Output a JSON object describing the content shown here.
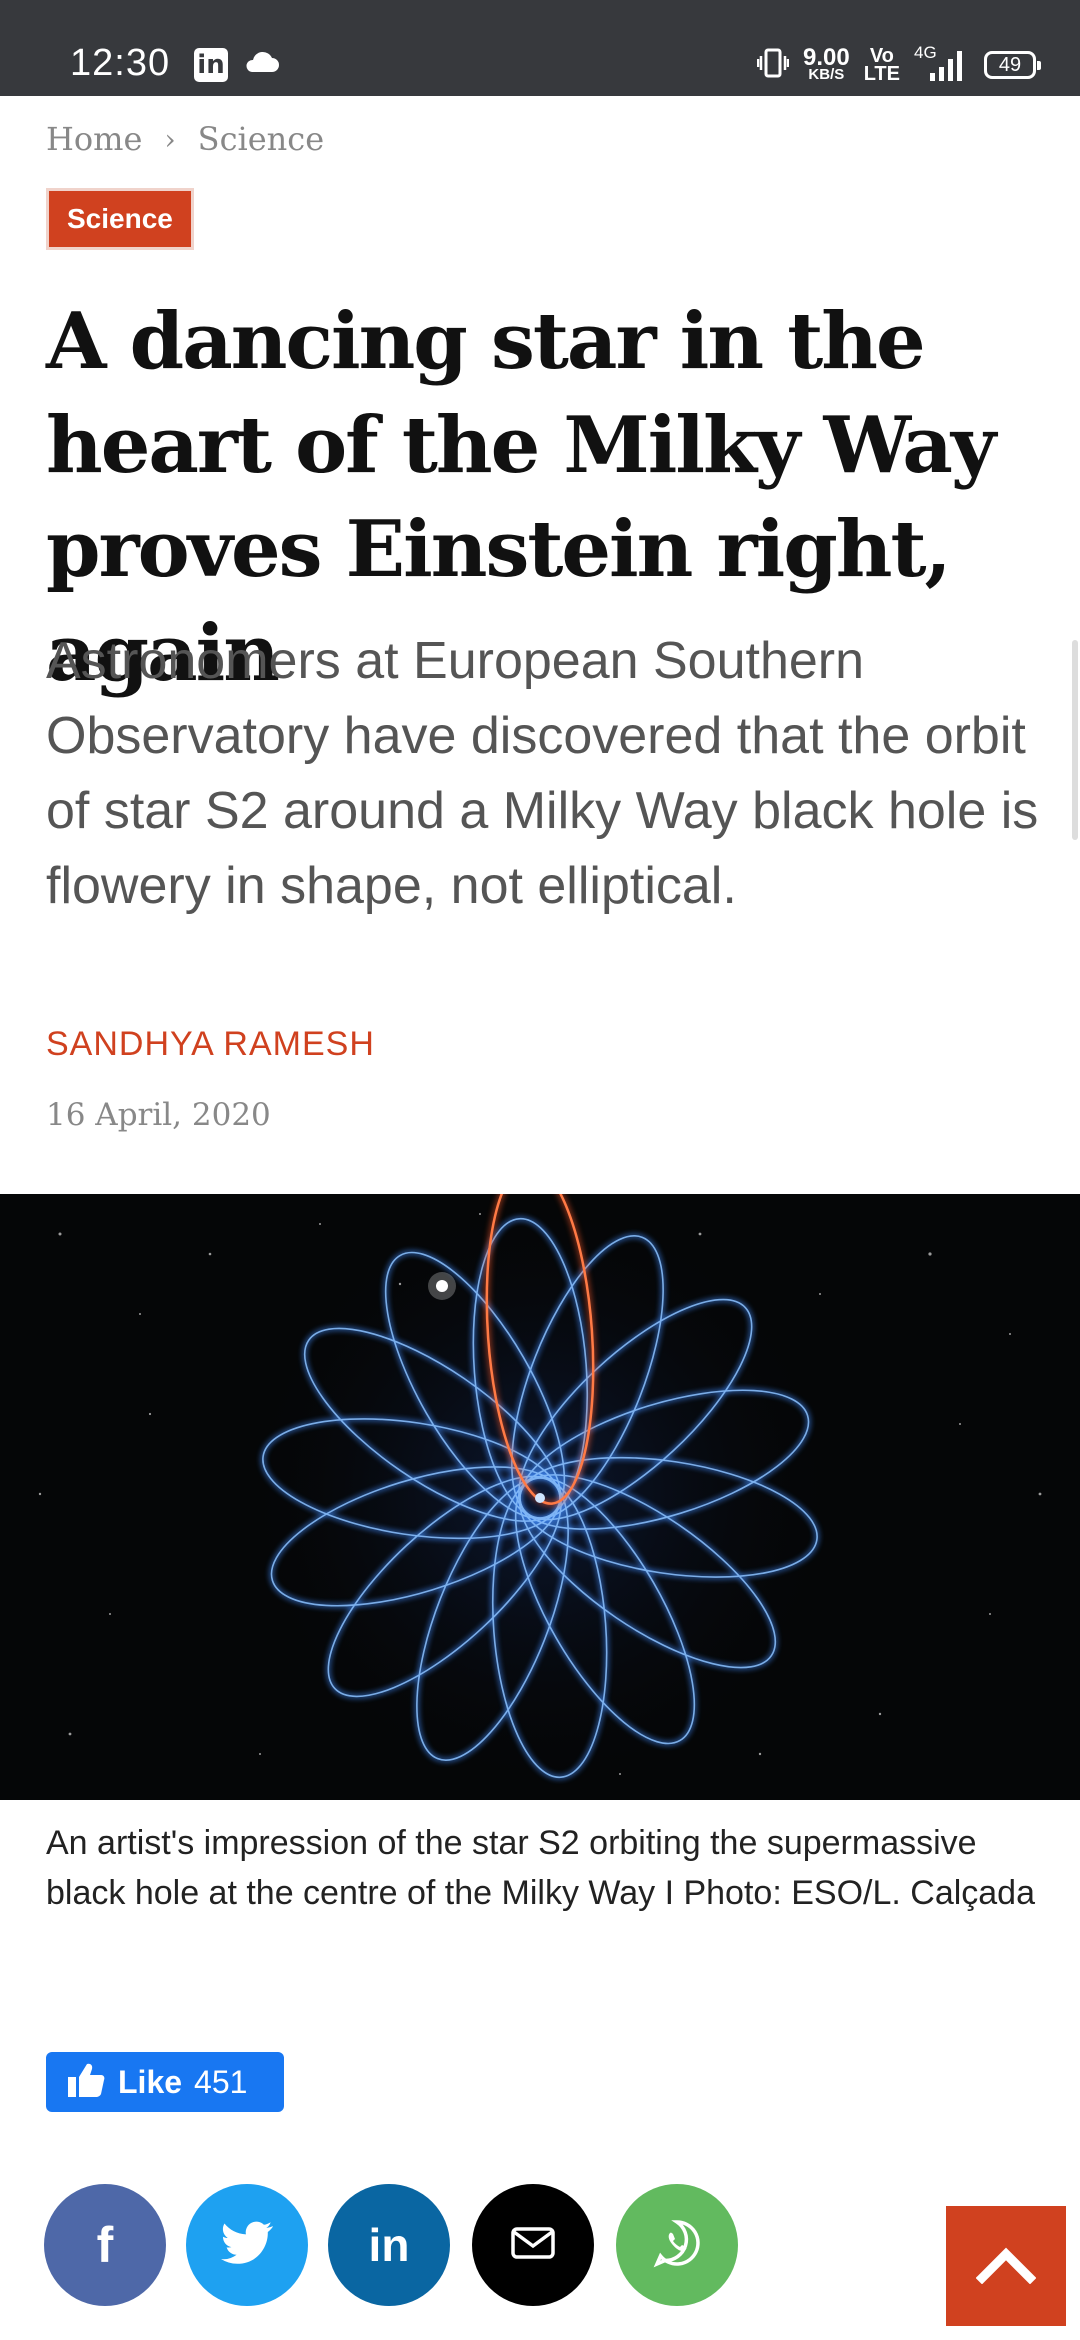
{
  "status_bar": {
    "time": "12:30",
    "linkedin_glyph": "in",
    "speed_value": "9.00",
    "speed_unit": "KB/S",
    "volte_top": "Vo",
    "volte_bottom": "LTE",
    "network": "4G",
    "battery": "49",
    "icons": [
      "linkedin-icon",
      "cloud-icon",
      "vibrate-icon",
      "signal-icon",
      "battery-icon"
    ]
  },
  "breadcrumb": {
    "home": "Home",
    "separator": "›",
    "current": "Science"
  },
  "category_badge": "Science",
  "article": {
    "title": "A dancing star in the heart of the Milky Way proves Einstein right, again",
    "subtitle": "Astronomers at European Southern Observatory have discovered that the orbit of star S2 around a Milky Way black hole is flowery in shape, not elliptical.",
    "author": "SANDHYA RAMESH",
    "date": "16 April, 2020",
    "image_caption": "An artist's impression of the star S2 orbiting the supermassive black hole at the centre of the Milky Way I Photo: ESO/L. Calçada"
  },
  "like_button": {
    "label": "Like",
    "count": "451"
  },
  "share_buttons": [
    {
      "name": "facebook-share-button",
      "icon": "facebook-icon",
      "glyph": "f",
      "color": "#4e68a8"
    },
    {
      "name": "twitter-share-button",
      "icon": "twitter-icon",
      "color": "#1ea1f1"
    },
    {
      "name": "linkedin-share-button",
      "icon": "linkedin-icon",
      "glyph": "in",
      "color": "#0a66a2"
    },
    {
      "name": "email-share-button",
      "icon": "mail-icon",
      "color": "#000000"
    },
    {
      "name": "whatsapp-share-button",
      "icon": "whatsapp-icon",
      "color": "#62ba5f"
    }
  ],
  "colors": {
    "accent": "#d0411f",
    "status_bar": "#37393d",
    "like_blue": "#1877f2"
  }
}
